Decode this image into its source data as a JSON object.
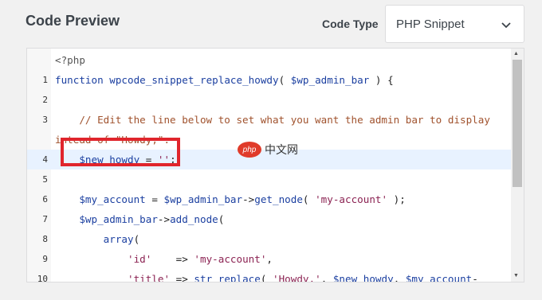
{
  "header": {
    "title": "Code Preview",
    "code_type_label": "Code Type",
    "code_type_value": "PHP Snippet",
    "chevron_icon": "chevron-down-icon"
  },
  "editor": {
    "language": "php",
    "lines": [
      {
        "num": "",
        "text": "<?php"
      },
      {
        "num": "1",
        "text": "function wpcode_snippet_replace_howdy( $wp_admin_bar ) {"
      },
      {
        "num": "2",
        "text": ""
      },
      {
        "num": "3",
        "text": "    // Edit the line below to set what you want the admin bar to display"
      },
      {
        "num": "",
        "text": "intead of \"Howdy,\"."
      },
      {
        "num": "4",
        "text": "    $new_howdy = '';"
      },
      {
        "num": "5",
        "text": ""
      },
      {
        "num": "6",
        "text": "    $my_account = $wp_admin_bar->get_node( 'my-account' );"
      },
      {
        "num": "7",
        "text": "    $wp_admin_bar->add_node("
      },
      {
        "num": "8",
        "text": "        array("
      },
      {
        "num": "9",
        "text": "            'id'    => 'my-account',"
      },
      {
        "num": "10",
        "text": "            'title' => str_replace( 'Howdy,', $new_howdy, $my_account-"
      }
    ],
    "active_line": "4"
  },
  "watermark": {
    "logo_text": "php",
    "text": "中文网"
  },
  "colors": {
    "highlight_border": "#e0252c",
    "keyword": "#1b3fa0",
    "string": "#8b2252",
    "comment": "#a0522d",
    "active_line_bg": "#e8f2ff"
  }
}
